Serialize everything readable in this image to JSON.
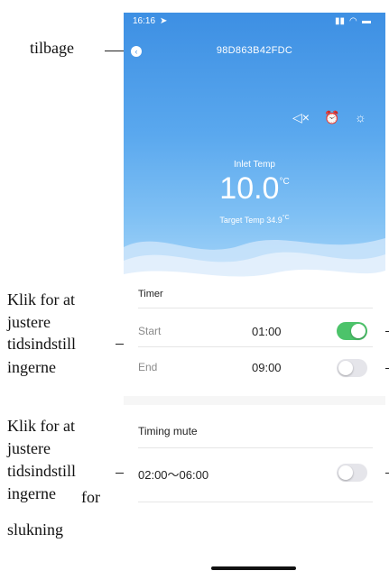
{
  "status_bar": {
    "time": "16:16",
    "icons": [
      "signal-icon",
      "wifi-icon",
      "battery-icon"
    ]
  },
  "header": {
    "title": "98D863B42FDC",
    "back_icon": "chevron-left-icon"
  },
  "controls": {
    "icons": [
      "mute-icon",
      "alarm-clock-icon",
      "brightness-icon"
    ]
  },
  "display": {
    "inlet_label": "Inlet Temp",
    "inlet_value": "10.0",
    "inlet_unit": "°C",
    "target_label": "Target Temp",
    "target_value": "34.9",
    "target_unit": "°C"
  },
  "timer": {
    "title": "Timer",
    "start_label": "Start",
    "start_time": "01:00",
    "start_enabled": true,
    "end_label": "End",
    "end_time": "09:00",
    "end_enabled": false
  },
  "timing_mute": {
    "title": "Timing mute",
    "range": "02:00～06:00",
    "enabled": false
  },
  "annotations": {
    "back": "tilbage",
    "timer_l1": "Klik for at",
    "timer_l2": "justere",
    "timer_l3": "tidsindstill",
    "timer_l4": "ingerne",
    "mute_l1": "Klik for at",
    "mute_l2": "justere",
    "mute_l3": "tidsindstill",
    "mute_l4": "ingerne",
    "mute_l4b": "for",
    "mute_l5": "slukning"
  },
  "colors": {
    "accent_blue": "#3d8fe3",
    "toggle_on": "#4cc36a",
    "toggle_off": "#e5e5ea"
  }
}
